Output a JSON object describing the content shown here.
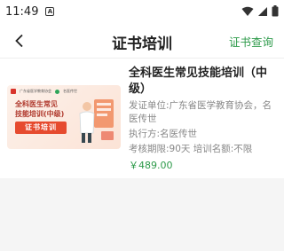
{
  "status": {
    "time": "11:49",
    "notification_badge": "A",
    "icons": [
      "wifi-icon",
      "signal-icon",
      "battery-icon"
    ]
  },
  "nav": {
    "back_icon": "chevron-left-icon",
    "title": "证书培训",
    "action": "证书查询"
  },
  "course": {
    "title": "全科医生常见技能培训（中级）",
    "issuer": "发证单位:广东省医学教育协会，名医传世",
    "executor": "执行方:名医传世",
    "period": "考核期限:90天 培训名额:不限",
    "price": "￥489.00",
    "thumbnail": {
      "org1": "广东省医学教育协会",
      "org2": "名医传世",
      "line1": "全科医生常见",
      "line2": "技能培训(中级)",
      "tag": "证书培训"
    }
  },
  "colors": {
    "accent": "#2d9a4a",
    "thumb_tag": "#e64b2f",
    "background_gray": "#f5f5f5"
  }
}
